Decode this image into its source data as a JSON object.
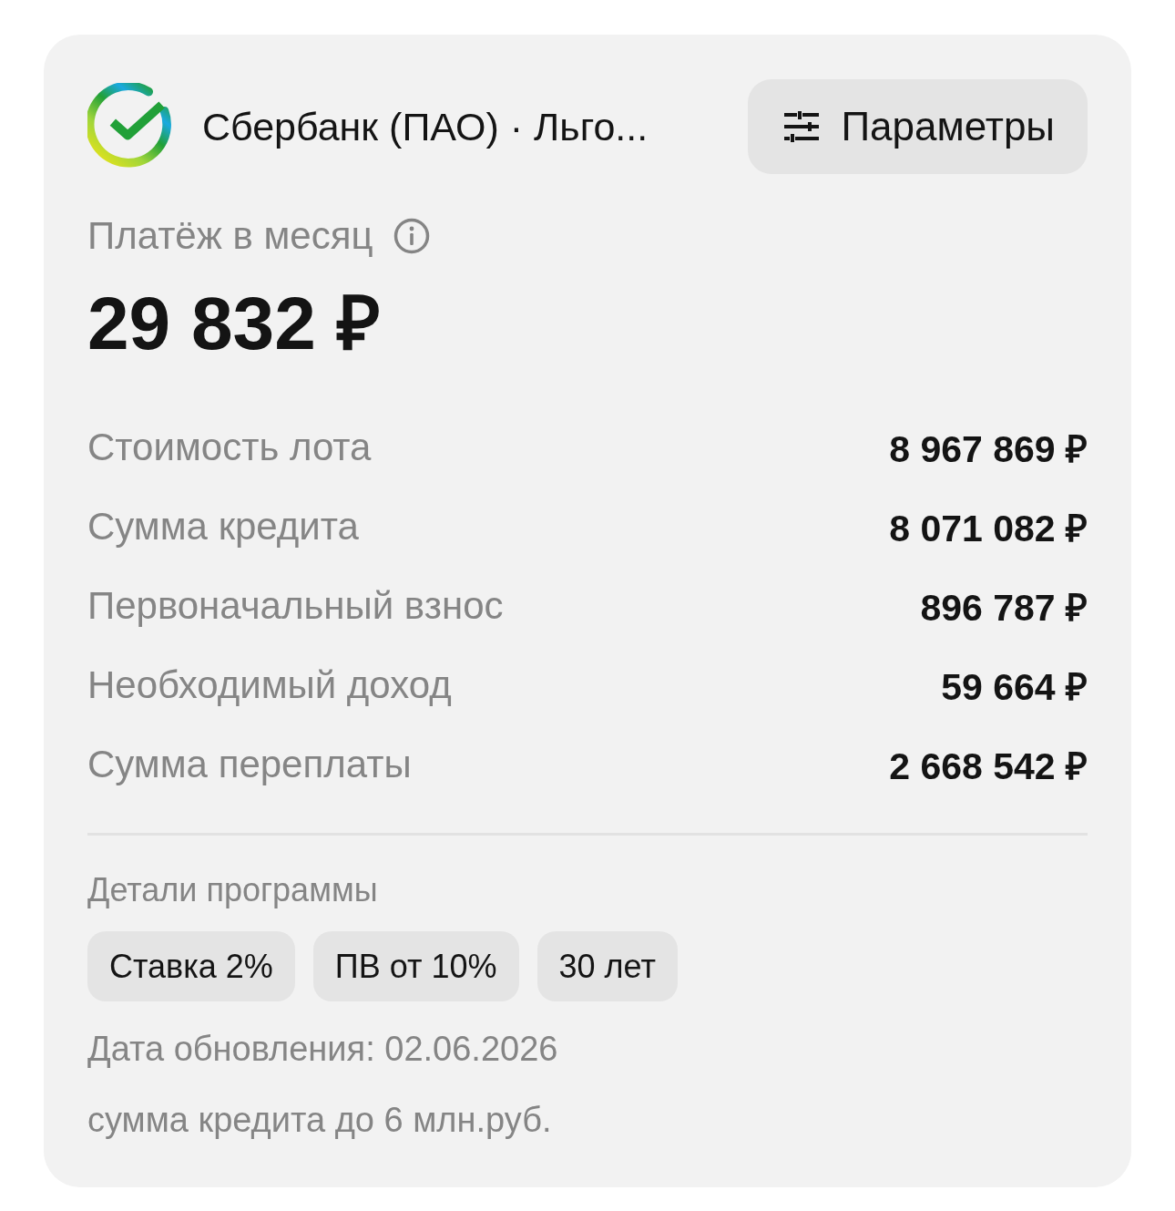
{
  "header": {
    "bank_name": "Сбербанк (ПАО) · Льго...",
    "params_button": "Параметры"
  },
  "payment": {
    "label": "Платёж в месяц",
    "amount": "29 832 ₽"
  },
  "rows": [
    {
      "label": "Стоимость лота",
      "value": "8 967 869 ₽"
    },
    {
      "label": "Сумма кредита",
      "value": "8 071 082 ₽"
    },
    {
      "label": "Первоначальный взнос",
      "value": "896 787 ₽"
    },
    {
      "label": "Необходимый доход",
      "value": "59 664 ₽"
    },
    {
      "label": "Сумма переплаты",
      "value": "2 668 542 ₽"
    }
  ],
  "details": {
    "title": "Детали программы",
    "chips": [
      "Ставка 2%",
      "ПВ от 10%",
      "30 лет"
    ],
    "updated": "Дата обновления: 02.06.2026",
    "note": "сумма кредита до 6 млн.руб."
  }
}
